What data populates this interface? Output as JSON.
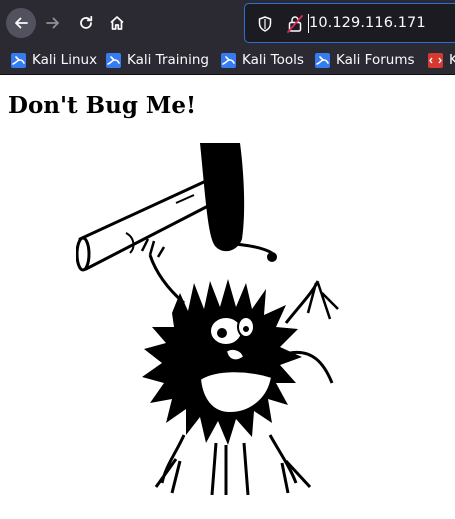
{
  "browser": {
    "url": "10.129.116.171",
    "icons": {
      "back": "arrow-left-icon",
      "forward": "arrow-right-icon",
      "reload": "reload-icon",
      "home": "home-icon",
      "tracking": "shield-icon",
      "insecure": "insecure-lock-icon",
      "bookmark": "kali-dragon-icon"
    },
    "colors": {
      "toolbar": "#2b2a33",
      "urlbar": "#1c1b22",
      "focus": "#2b71d5"
    }
  },
  "bookmarks": [
    {
      "label": "Kali Linux"
    },
    {
      "label": "Kali Training"
    },
    {
      "label": "Kali Tools"
    },
    {
      "label": "Kali Forums"
    },
    {
      "label": "K"
    }
  ],
  "page": {
    "title": "Don't Bug Me!"
  }
}
